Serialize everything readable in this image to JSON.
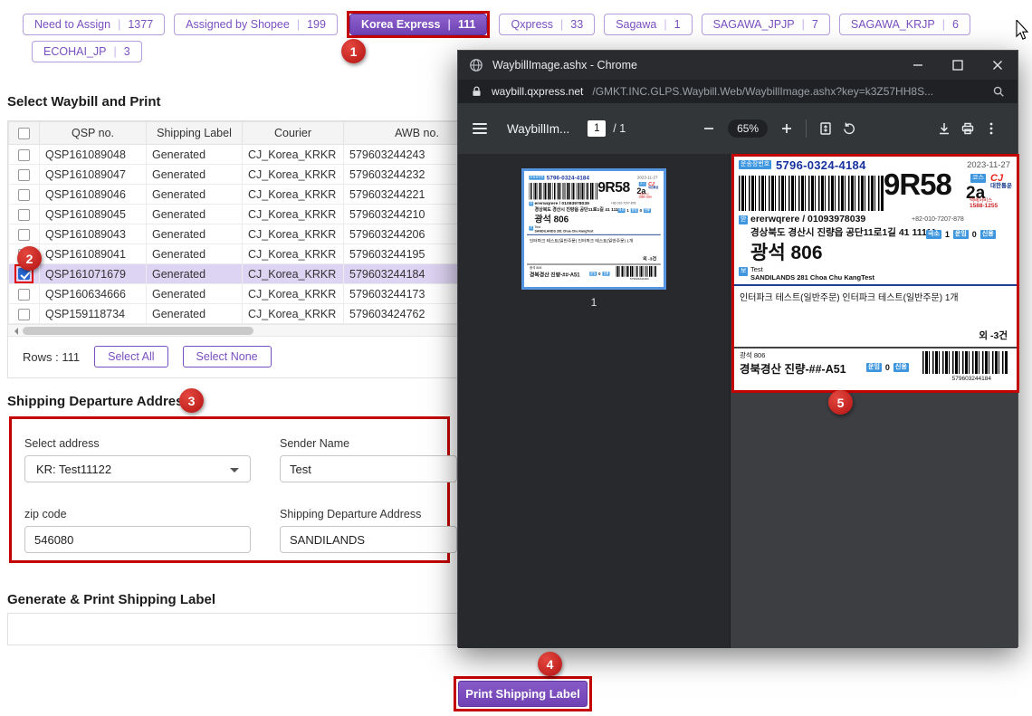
{
  "ui": {
    "separator": "|"
  },
  "filters": {
    "row1": [
      {
        "label": "Need to Assign",
        "count": "1377"
      },
      {
        "label": "Assigned by Shopee",
        "count": "199"
      },
      {
        "label": "Korea Express",
        "count": "111"
      },
      {
        "label": "Qxpress",
        "count": "33"
      },
      {
        "label": "Sagawa",
        "count": "1"
      },
      {
        "label": "SAGAWA_JPJP",
        "count": "7"
      },
      {
        "label": "SAGAWA_KRJP",
        "count": "6"
      }
    ],
    "row2": [
      {
        "label": "ECOHAI_JP",
        "count": "3"
      }
    ]
  },
  "waybill_section": {
    "title": "Select Waybill and Print",
    "columns": [
      "QSP no.",
      "Shipping Label",
      "Courier",
      "AWB no."
    ],
    "rows": [
      {
        "qsp": "QSP161089048",
        "label": "Generated",
        "courier": "CJ_Korea_KRKR",
        "awb": "579603244243",
        "checked": false
      },
      {
        "qsp": "QSP161089047",
        "label": "Generated",
        "courier": "CJ_Korea_KRKR",
        "awb": "579603244232",
        "checked": false
      },
      {
        "qsp": "QSP161089046",
        "label": "Generated",
        "courier": "CJ_Korea_KRKR",
        "awb": "579603244221",
        "checked": false
      },
      {
        "qsp": "QSP161089045",
        "label": "Generated",
        "courier": "CJ_Korea_KRKR",
        "awb": "579603244210",
        "checked": false
      },
      {
        "qsp": "QSP161089043",
        "label": "Generated",
        "courier": "CJ_Korea_KRKR",
        "awb": "579603244206",
        "checked": false
      },
      {
        "qsp": "QSP161089041",
        "label": "Generated",
        "courier": "CJ_Korea_KRKR",
        "awb": "579603244195",
        "checked": false
      },
      {
        "qsp": "QSP161071679",
        "label": "Generated",
        "courier": "CJ_Korea_KRKR",
        "awb": "579603244184",
        "checked": true
      },
      {
        "qsp": "QSP160634666",
        "label": "Generated",
        "courier": "CJ_Korea_KRKR",
        "awb": "579603244173",
        "checked": false
      },
      {
        "qsp": "QSP159118734",
        "label": "Generated",
        "courier": "CJ_Korea_KRKR",
        "awb": "579603424762",
        "checked": false
      }
    ],
    "rows_count_label": "Rows : 111",
    "select_all_label": "Select All",
    "select_none_label": "Select None"
  },
  "address_section": {
    "title": "Shipping Departure Address",
    "select_address_label": "Select address",
    "select_address_value": "KR: Test11122",
    "sender_name_label": "Sender Name",
    "sender_name_value": "Test",
    "zip_label": "zip code",
    "zip_value": "546080",
    "departure_label": "Shipping Departure Address",
    "departure_value": "SANDILANDS"
  },
  "generate_section": {
    "title": "Generate & Print Shipping Label",
    "print_button_label": "Print Shipping Label"
  },
  "chrome": {
    "window_title": "WaybillImage.ashx - Chrome",
    "url_domain": "waybill.qxpress.net",
    "url_path": "/GMKT.INC.GLPS.Waybill.Web/WaybillImage.ashx?key=k3Z57HH8S...",
    "pdf": {
      "doc_title": "WaybillIm...",
      "page_current": "1",
      "page_total": "/ 1",
      "zoom_level": "65%",
      "thumbnail_page_number": "1"
    }
  },
  "waybill_label": {
    "tracking_badge": "운송장번호",
    "tracking_number": "5796-0324-4184",
    "date": "2023-11-27",
    "sort_code_big": "9R58",
    "sort_code_small": "2a",
    "courier_badge": "코스",
    "logo_cj": "CJ",
    "logo_rest": "대한통운",
    "service_line1": "택배서비스",
    "service_line2": "1588-1255",
    "receiver_badge": "받",
    "receiver": "ererwqrere / 01093978039",
    "address": "경상북도 경산시 진량읍 공단11로1길 41 11111",
    "area_code": "광석 806",
    "phone": "+82-010-7207-878",
    "size_badge": "극소",
    "size_value": "1",
    "fee_badge": "운임",
    "fee_value": "0",
    "pay_badge": "신용",
    "sender_badge": "보",
    "sender_name": "Test",
    "sender_address": "SANDILANDS 281 Choa Chu KangTest",
    "item_line": "인터파크 테스트(일반주문) 인터파크 테스트(일반주문) 1개",
    "extra_count": "외 -3건",
    "bottom_area": "광석 806",
    "bottom_code": "경북경산 진량-##-A51",
    "bottom_fee_badge": "운임",
    "bottom_fee_value": "0",
    "bottom_pay_badge": "신용",
    "bottom_barcode_number": "579603244184"
  },
  "annotations": {
    "step1": "1",
    "step2": "2",
    "step3": "3",
    "step4": "4",
    "step5": "5"
  }
}
